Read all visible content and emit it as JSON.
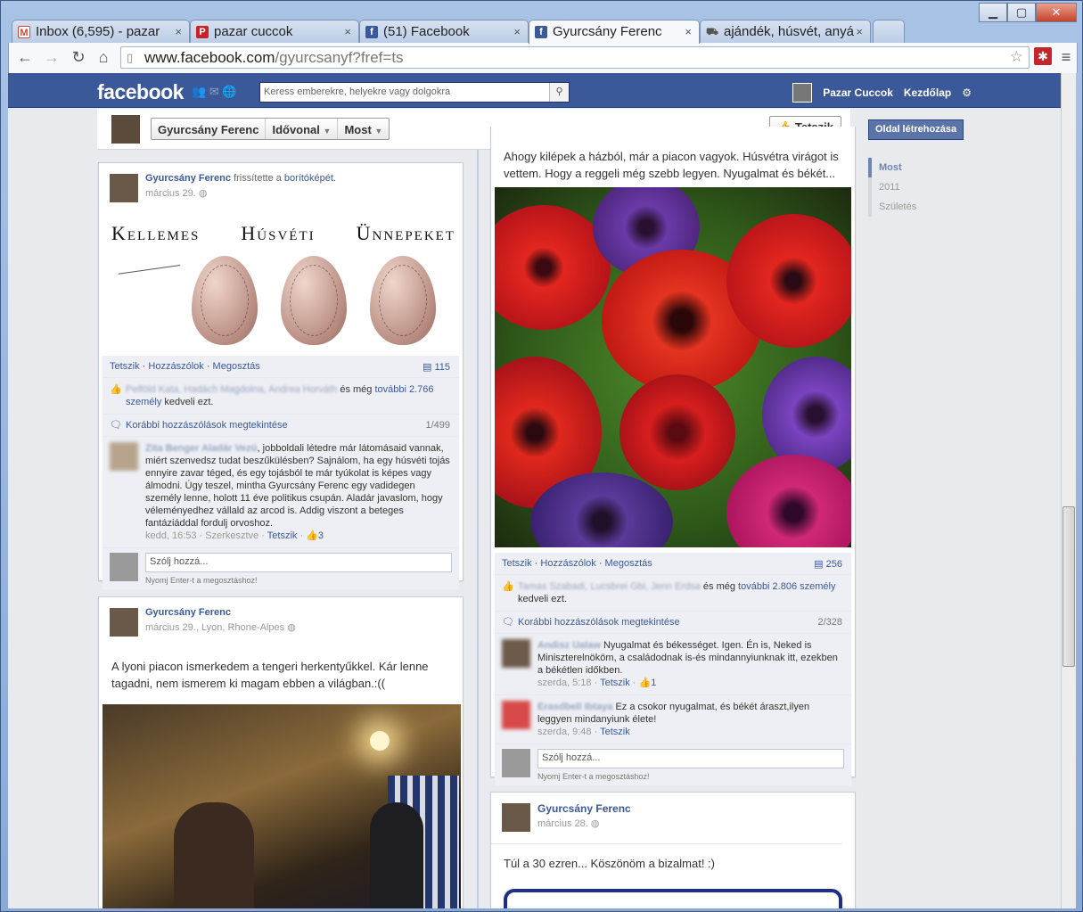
{
  "browser": {
    "tabs": [
      {
        "label": "Inbox (6,595) - pazar",
        "icon": "gmail-icon",
        "icon_color": "#d44638"
      },
      {
        "label": "pazar cuccok",
        "icon": "pinterest-icon",
        "icon_color": "#cb2027"
      },
      {
        "label": "(51) Facebook",
        "icon": "facebook-icon",
        "icon_color": "#3b5998"
      },
      {
        "label": "Gyurcsány Ferenc",
        "icon": "facebook-icon",
        "icon_color": "#3b5998"
      },
      {
        "label": "ajándék, húsvét, anyá",
        "icon": "cart-icon",
        "icon_color": "#777"
      }
    ],
    "close_glyph": "×",
    "url_host": "www.facebook.com",
    "url_path": "/gyurcsanyf?fref=ts"
  },
  "fb": {
    "logo": "facebook",
    "search_placeholder": "Keress emberekre, helyekre vagy dolgokra",
    "user_name": "Pazar Cuccok",
    "home": "Kezdőlap"
  },
  "page_header": {
    "name": "Gyurcsány Ferenc",
    "timeline": "Idővonal",
    "now": "Most",
    "like_button": "Tetszik"
  },
  "right_col": {
    "create_page": "Oldal létrehozása",
    "timeline_items": [
      "Most",
      "2011",
      "Születés"
    ]
  },
  "post1": {
    "author": "Gyurcsány Ferenc",
    "action": "frissítette a",
    "action_link": "borítóképét.",
    "date": "március 29.",
    "image_title_words": [
      "Kellemes",
      "Húsvéti",
      "Ünnepeket"
    ],
    "actions": [
      "Tetszik",
      "Hozzászólok",
      "Megosztás"
    ],
    "comment_count": "115",
    "likers": "Pelföld Kata, Hadách Magdolna, Andrea Horváth",
    "likes_mid": "és még",
    "likes_more": "további 2.766",
    "likes_tail1": "személy",
    "likes_tail2": "kedveli ezt.",
    "view_previous": "Korábbi hozzászólások megtekintése",
    "view_count": "1/499",
    "comment": {
      "author": "Zita Benger Aladár Vezü",
      "text": ", jobboldali létedre már látomásaid vannak, miért szenvedsz tudat beszűkülésben? Sajnálom, ha egy húsvéti tojás ennyire zavar téged, és egy tojásból te már tyúkolat is képes vagy álmodni. Úgy teszel, mintha Gyurcsány Ferenc egy vadidegen személy lenne, holott 11 éve politikus csupán. Aladár javaslom, hogy véleményedhez vállald az arcod is. Addig viszont a beteges fantáziáddal fordulj orvoshoz.",
      "time": "kedd, 16:53",
      "edited": "Szerkesztve",
      "like": "Tetszik",
      "likes": "3"
    },
    "reply_placeholder": "Szólj hozzá...",
    "reply_hint": "Nyomj Enter-t a megosztáshoz!"
  },
  "post2": {
    "author": "Gyurcsány Ferenc",
    "date": "március 29., Lyon, Rhone-Alpes",
    "text": "A lyoni piacon ismerkedem a tengeri herkentyűkkel. Kár lenne tagadni, nem ismerem ki magam ebben a világban.:(("
  },
  "post3": {
    "text_top": "Ahogy kilépek a házból, már a piacon vagyok. Húsvétra virágot is vettem. Hogy a reggeli még szebb legyen. Nyugalmat és békét...",
    "actions": [
      "Tetszik",
      "Hozzászólok",
      "Megosztás"
    ],
    "comment_count": "256",
    "likers": "Tamas Szabadi, Lucsbrei Gbi, Jenn Erdsa",
    "likes_mid": "és még",
    "likes_more": "további 2.806 személy",
    "likes_tail": "kedveli ezt.",
    "view_previous": "Korábbi hozzászólások megtekintése",
    "view_count": "2/328",
    "comments": [
      {
        "author": "Andisz Ualaw",
        "text": "Nyugalmat és békességet. Igen. Én is, Neked is Miniszterelnököm, a családodnak is-és mindannyiunknak itt, ezekben a békétlen időkben.",
        "time": "szerda, 5:18",
        "like": "Tetszik",
        "likes": "1"
      },
      {
        "author": "Erasdbell Ibtaya",
        "text": "Ez a csokor nyugalmat, és békét áraszt,ilyen leggyen mindanyiunk élete!",
        "time": "szerda, 9:48",
        "like": "Tetszik",
        "likes": ""
      }
    ],
    "reply_placeholder": "Szólj hozzá...",
    "reply_hint": "Nyomj Enter-t a megosztáshoz!"
  },
  "post4": {
    "author": "Gyurcsány Ferenc",
    "date": "március 28.",
    "text": "Túl a 30 ezren... Köszönöm a bizalmat! :)"
  },
  "colors": {
    "fb_blue": "#3b5998",
    "page_bg": "#e9eaed"
  }
}
